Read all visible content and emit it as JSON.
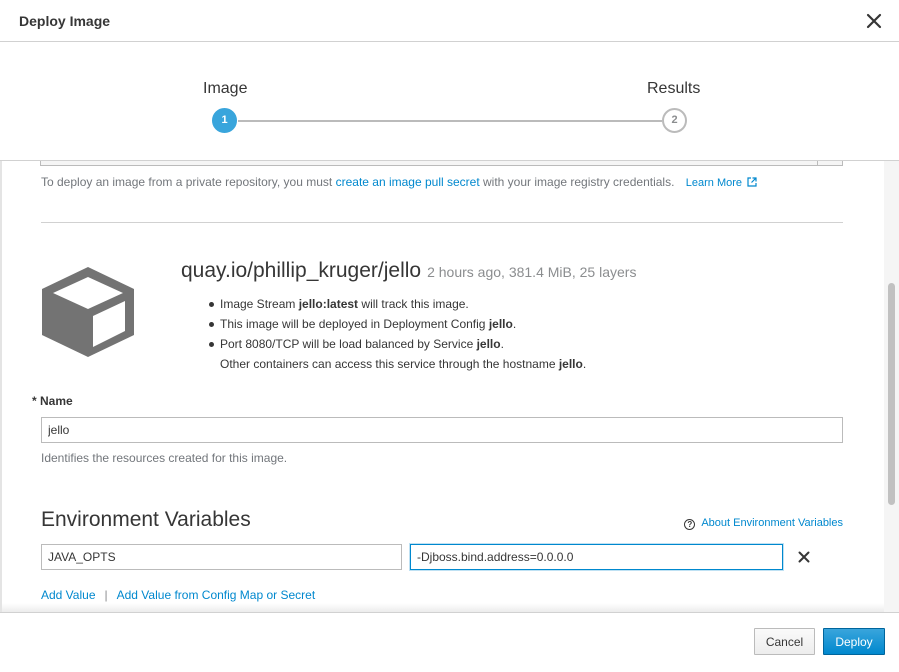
{
  "modal": {
    "title": "Deploy Image"
  },
  "wizard": {
    "steps": [
      {
        "label": "Image",
        "number": "1",
        "active": true
      },
      {
        "label": "Results",
        "number": "2",
        "active": false
      }
    ]
  },
  "help": {
    "prefix": "To deploy an image from a private repository, you must ",
    "link": "create an image pull secret",
    "suffix": " with your image registry credentials.",
    "learn_more": "Learn More"
  },
  "image": {
    "name": "quay.io/phillip_kruger/jello",
    "meta": "2 hours ago, 381.4 MiB, 25 layers",
    "info": [
      {
        "pre": "Image Stream ",
        "bold": "jello:latest",
        "post": " will track this image."
      },
      {
        "pre": "This image will be deployed in Deployment Config ",
        "bold": "jello",
        "post": "."
      },
      {
        "pre": "Port 8080/TCP will be load balanced by Service ",
        "bold": "jello",
        "post": "."
      },
      {
        "pre": "Other containers can access this service through the hostname ",
        "bold": "jello",
        "post": "."
      }
    ]
  },
  "name_field": {
    "label": "* Name",
    "value": "jello",
    "help": "Identifies the resources created for this image."
  },
  "env": {
    "title": "Environment Variables",
    "about_link": "About Environment Variables",
    "key": "JAVA_OPTS",
    "value": "-Djboss.bind.address=0.0.0.0",
    "add_value": "Add Value",
    "separator": "|",
    "add_from_config": "Add Value from Config Map or Secret"
  },
  "footer": {
    "cancel_label": "Cancel",
    "deploy_label": "Deploy"
  },
  "colors": {
    "accent": "#0088ce",
    "step_active": "#39a5dc",
    "primary_button": "#0088ce"
  },
  "icons": [
    "close-icon",
    "cube-icon",
    "help-circle-icon",
    "external-link-icon",
    "remove-icon"
  ]
}
